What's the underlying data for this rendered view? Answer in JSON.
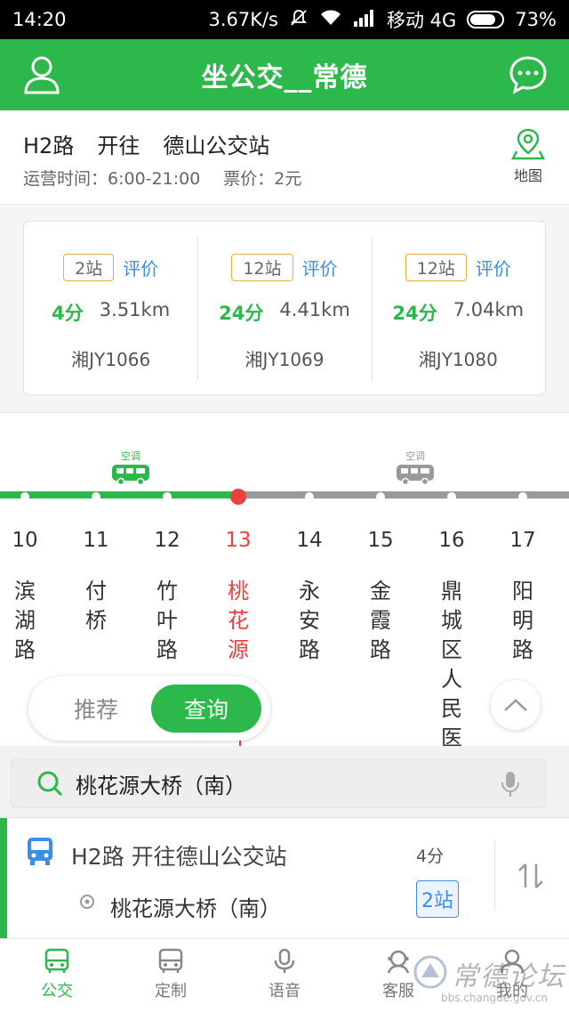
{
  "status_bar": {
    "time": "14:20",
    "speed": "3.67K/s",
    "carrier": "移动 4G",
    "battery": "73%"
  },
  "header": {
    "title": "坐公交__常德"
  },
  "route": {
    "line": "H2路",
    "direction_word": "开往",
    "terminal": "德山公交站",
    "hours": "运营时间：6:00-21:00",
    "fare": "票价：2元",
    "map_label": "地图"
  },
  "buses": [
    {
      "stops": "2站",
      "rate": "评价",
      "minutes": "4分",
      "distance": "3.51km",
      "plate": "湘JY1066"
    },
    {
      "stops": "12站",
      "rate": "评价",
      "minutes": "24分",
      "distance": "4.41km",
      "plate": "湘JY1069"
    },
    {
      "stops": "12站",
      "rate": "评价",
      "minutes": "24分",
      "distance": "7.04km",
      "plate": "湘JY1080"
    }
  ],
  "strip": {
    "ac_label": "空调",
    "stops": [
      {
        "num": "10",
        "name": "滨湖路"
      },
      {
        "num": "11",
        "name": "付桥"
      },
      {
        "num": "12",
        "name": "竹叶路"
      },
      {
        "num": "13",
        "name": "桃花源"
      },
      {
        "num": "14",
        "name": "永安路"
      },
      {
        "num": "15",
        "name": "金霞路"
      },
      {
        "num": "16",
        "name": "鼎城区人民医"
      },
      {
        "num": "17",
        "name": "阳明路"
      }
    ]
  },
  "toggle": {
    "recommend": "推荐",
    "query": "查询"
  },
  "search": {
    "value": "桃花源大桥（南）"
  },
  "favorite": {
    "route": "H2路 开往德山公交站",
    "eta": "4分",
    "stop": "桃花源大桥（南）",
    "stops_away": "2站"
  },
  "nav": [
    {
      "label": "公交",
      "icon": "bus-icon"
    },
    {
      "label": "定制",
      "icon": "custom-bus-icon"
    },
    {
      "label": "语音",
      "icon": "microphone-icon"
    },
    {
      "label": "客服",
      "icon": "service-icon"
    },
    {
      "label": "我的",
      "icon": "profile-icon"
    }
  ],
  "watermark": {
    "text": "常德论坛",
    "url": "bbs.changde.gov.cn"
  },
  "colors": {
    "brand_green": "#2db84b",
    "current_red": "#e94040",
    "link_blue": "#3a8ee6"
  }
}
